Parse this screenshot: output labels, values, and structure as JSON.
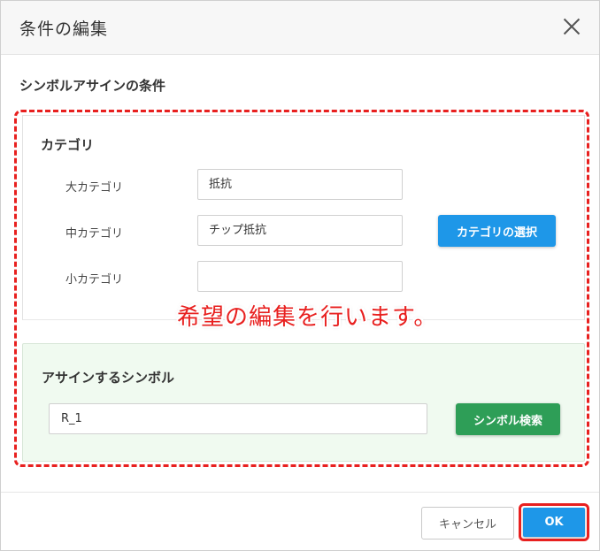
{
  "dialog": {
    "title": "条件の編集",
    "close_icon": "close-icon"
  },
  "section_title": "シンボルアサインの条件",
  "category": {
    "title": "カテゴリ",
    "fields": [
      {
        "label": "大カテゴリ",
        "value": "抵抗"
      },
      {
        "label": "中カテゴリ",
        "value": "チップ抵抗"
      },
      {
        "label": "小カテゴリ",
        "value": ""
      }
    ],
    "select_button": "カテゴリの選択"
  },
  "symbol": {
    "title": "アサインするシンボル",
    "value": "R_1",
    "search_button": "シンボル検索"
  },
  "annotation": {
    "text": "希望の編集を行います。",
    "color": "#e8201f"
  },
  "footer": {
    "cancel": "キャンセル",
    "ok": "OK"
  },
  "colors": {
    "primary": "#1e97e8",
    "success": "#2e9e57",
    "symbol_panel_bg": "#f0faf0"
  }
}
